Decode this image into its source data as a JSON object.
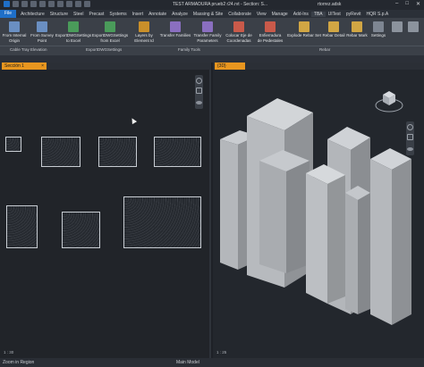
{
  "titlebar": {
    "title": "TEST ARMADURA prueb2 r24.rvt - Section: S...",
    "user": "rtorrez.adsk",
    "minimize": "–",
    "maximize": "□",
    "close": "✕"
  },
  "menubar": {
    "items": [
      "File",
      "Architecture",
      "Structure",
      "Steel",
      "Precast",
      "Systems",
      "Insert",
      "Annotate",
      "Analyze",
      "Massing & Site",
      "Collaborate",
      "View",
      "Manage",
      "Add-Ins",
      "TBA",
      "UITest",
      "pyRevit",
      "HQR S.p.A"
    ]
  },
  "ribbon": {
    "buttons": [
      {
        "label": "From Internal\nOrigin",
        "color": "#6a8fc2"
      },
      {
        "label": "From Survey\nPoint",
        "color": "#6a8fc2"
      },
      {
        "label": "ExportDWGSettings\nto Excel",
        "color": "#4a9b5a"
      },
      {
        "label": "ExportDWGSettings\nfrom Excel",
        "color": "#4a9b5a"
      },
      {
        "label": "Layers by\nElement Id",
        "color": "#c98f2a"
      },
      {
        "label": "Transfer Families",
        "color": "#8a6fc0"
      },
      {
        "label": "Transfer Family\nParameters",
        "color": "#8a6fc0"
      },
      {
        "label": "Colocar Eje de\nCoordenadas",
        "color": "#c95a4a"
      },
      {
        "label": "Enfierradura\nde Pedestales",
        "color": "#c95a4a"
      },
      {
        "label": "Explode Rebar Set",
        "color": "#d1a644"
      },
      {
        "label": "Rebar Detail",
        "color": "#d1a644"
      },
      {
        "label": "Rebar Mark",
        "color": "#d1a644"
      },
      {
        "label": "Settings",
        "color": "#7e8692"
      }
    ],
    "panels": [
      "Cable Tray Elevation",
      "ExportDWGSettings",
      "Family Tools",
      "Rebar"
    ]
  },
  "left_view": {
    "tab_label": "Sección 1",
    "tab_close": "×",
    "scale": "1 : 30"
  },
  "right_view": {
    "tab_label": "{3D}",
    "scale": "1 : 25"
  },
  "status": {
    "text": "Zoom in Region",
    "model": "Main Model"
  }
}
